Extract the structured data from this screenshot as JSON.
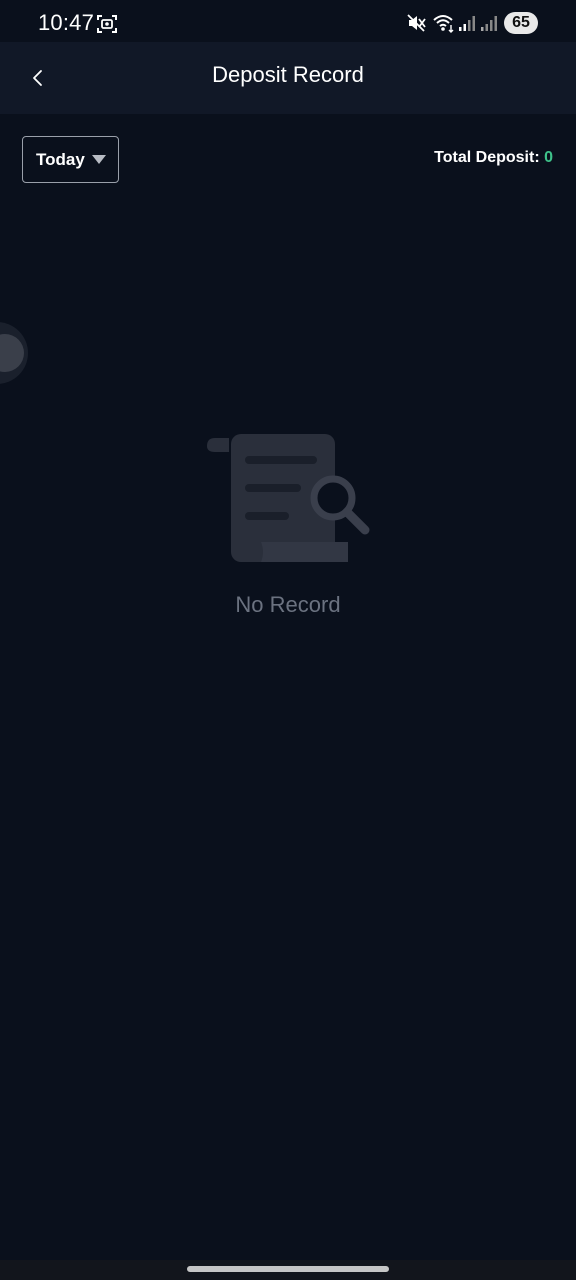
{
  "status_bar": {
    "time": "10:47",
    "battery": "65",
    "icons": [
      "screenshot-icon",
      "mute-icon",
      "wifi-icon",
      "signal-icon",
      "signal-icon"
    ]
  },
  "header": {
    "title": "Deposit Record",
    "back_icon": "chevron-left-icon"
  },
  "filter": {
    "selected": "Today",
    "icon": "caret-down-icon"
  },
  "summary": {
    "label": "Total Deposit: ",
    "value": "0"
  },
  "empty_state": {
    "message": "No Record",
    "icon": "document-search-icon"
  },
  "colors": {
    "background": "#0a101c",
    "header": "#111827",
    "accent_green": "#3ec28a",
    "muted_text": "#6b7280"
  }
}
